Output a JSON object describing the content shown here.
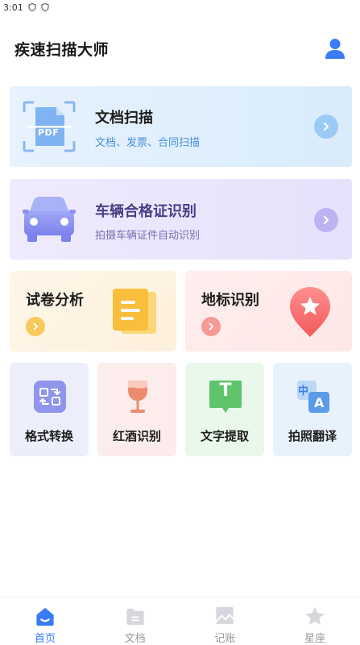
{
  "status_bar": {
    "time": "3:01"
  },
  "header": {
    "title": "疾速扫描大师"
  },
  "cards": {
    "doc_scan": {
      "title": "文档扫描",
      "subtitle": "文档、发票、合同扫描",
      "icon_text": "PDF"
    },
    "car_cert": {
      "title": "车辆合格证识别",
      "subtitle": "拍摄车辆证件自动识别"
    }
  },
  "half_cards": {
    "exam": {
      "title": "试卷分析"
    },
    "landmark": {
      "title": "地标识别"
    }
  },
  "tiles": [
    {
      "label": "格式转换"
    },
    {
      "label": "红酒识别"
    },
    {
      "label": "文字提取",
      "icon_text": "T"
    },
    {
      "label": "拍照翻译",
      "icon_text_a": "中",
      "icon_text_b": "A"
    }
  ],
  "tabbar": {
    "tabs": [
      {
        "label": "首页",
        "active": true
      },
      {
        "label": "文档",
        "active": false
      },
      {
        "label": "记账",
        "active": false
      },
      {
        "label": "星座",
        "active": false
      }
    ]
  },
  "colors": {
    "accent": "#3b7cf6",
    "doc_subtitle": "#4a90d9",
    "car_title": "#4a3d86",
    "car_subtitle": "#7a6fb0"
  }
}
